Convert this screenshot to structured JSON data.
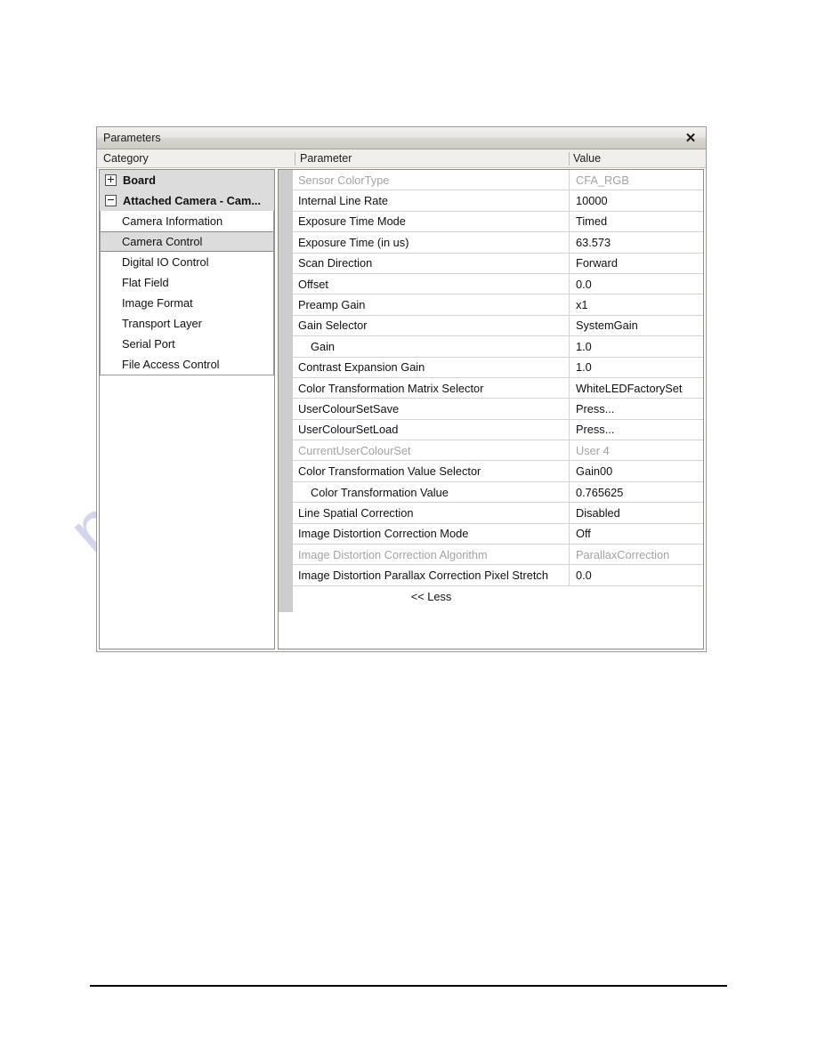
{
  "window": {
    "title": "Parameters",
    "close_icon": "close-icon",
    "close_glyph": "✕"
  },
  "columns": {
    "category": "Category",
    "parameter": "Parameter",
    "value": "Value"
  },
  "category_tree": [
    {
      "label": "Board",
      "level": 0,
      "toggle": "plus",
      "selected": false
    },
    {
      "label": "Attached Camera - Cam...",
      "level": 0,
      "toggle": "minus",
      "selected": false
    },
    {
      "label": "Camera Information",
      "level": 1,
      "toggle": "none",
      "selected": false
    },
    {
      "label": "Camera Control",
      "level": 1,
      "toggle": "none",
      "selected": true
    },
    {
      "label": "Digital IO Control",
      "level": 1,
      "toggle": "none",
      "selected": false
    },
    {
      "label": "Flat Field",
      "level": 1,
      "toggle": "none",
      "selected": false
    },
    {
      "label": "Image Format",
      "level": 1,
      "toggle": "none",
      "selected": false
    },
    {
      "label": "Transport Layer",
      "level": 1,
      "toggle": "none",
      "selected": false
    },
    {
      "label": "Serial Port",
      "level": 1,
      "toggle": "none",
      "selected": false
    },
    {
      "label": "File Access Control",
      "level": 1,
      "toggle": "none",
      "selected": false
    }
  ],
  "parameters": [
    {
      "name": "Sensor ColorType",
      "value": "CFA_RGB",
      "disabled": true,
      "indent": false
    },
    {
      "name": "Internal Line Rate",
      "value": "10000",
      "disabled": false,
      "indent": false
    },
    {
      "name": "Exposure Time Mode",
      "value": "Timed",
      "disabled": false,
      "indent": false
    },
    {
      "name": "Exposure Time (in us)",
      "value": "63.573",
      "disabled": false,
      "indent": false
    },
    {
      "name": "Scan Direction",
      "value": "Forward",
      "disabled": false,
      "indent": false
    },
    {
      "name": "Offset",
      "value": "0.0",
      "disabled": false,
      "indent": false
    },
    {
      "name": "Preamp Gain",
      "value": "x1",
      "disabled": false,
      "indent": false
    },
    {
      "name": "Gain Selector",
      "value": "SystemGain",
      "disabled": false,
      "indent": false
    },
    {
      "name": "Gain",
      "value": "1.0",
      "disabled": false,
      "indent": true
    },
    {
      "name": "Contrast Expansion Gain",
      "value": "1.0",
      "disabled": false,
      "indent": false
    },
    {
      "name": "Color Transformation Matrix Selector",
      "value": "WhiteLEDFactorySet",
      "disabled": false,
      "indent": false
    },
    {
      "name": "UserColourSetSave",
      "value": "Press...",
      "disabled": false,
      "indent": false
    },
    {
      "name": "UserColourSetLoad",
      "value": "Press...",
      "disabled": false,
      "indent": false
    },
    {
      "name": "CurrentUserColourSet",
      "value": "User 4",
      "disabled": true,
      "indent": false
    },
    {
      "name": "Color Transformation Value Selector",
      "value": "Gain00",
      "disabled": false,
      "indent": false
    },
    {
      "name": "Color Transformation Value",
      "value": "0.765625",
      "disabled": false,
      "indent": true
    },
    {
      "name": "Line Spatial Correction",
      "value": "Disabled",
      "disabled": false,
      "indent": false
    },
    {
      "name": "Image Distortion Correction Mode",
      "value": "Off",
      "disabled": false,
      "indent": false
    },
    {
      "name": "Image Distortion Correction Algorithm",
      "value": "ParallaxCorrection",
      "disabled": true,
      "indent": false
    },
    {
      "name": "Image Distortion Parallax Correction Pixel Stretch",
      "value": "0.0",
      "disabled": false,
      "indent": false
    }
  ],
  "footer": {
    "less_label": "<< Less"
  },
  "watermark": {
    "text": "manualshive.com"
  },
  "colors": {
    "titlebar_top": "#f3f2ef",
    "titlebar_bottom": "#cfccc4",
    "selected_row": "#dcdcdc",
    "disabled_text": "#a3a3a3",
    "grid_line": "#d6d3cd",
    "scroll_thumb": "#cdcdcd",
    "watermark": "#b9bce6"
  }
}
